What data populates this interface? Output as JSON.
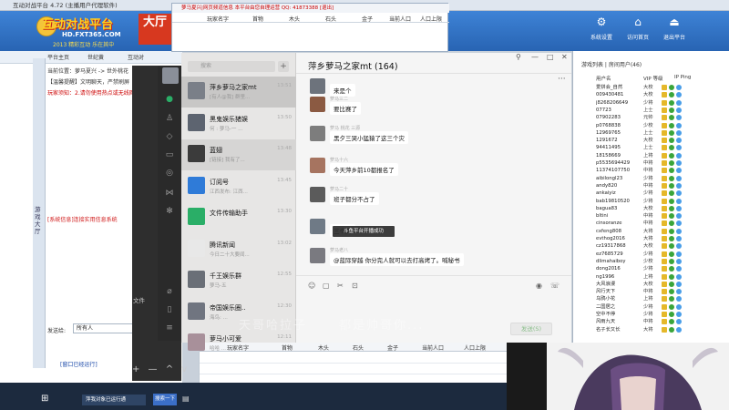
{
  "bg_window": {
    "title": "互动对战平台 4.72 (主播用户代理软件)",
    "logo_main": "互动对战平台",
    "logo_url": "HD.FXT365.COM",
    "logo_slogan": "2013 精彩互动 乐在其中",
    "hall_banner": "大厅",
    "top_buttons": [
      {
        "label": "系统设置",
        "icon": "gear-icon"
      },
      {
        "label": "访问首页",
        "icon": "home-icon"
      },
      {
        "label": "退出平台",
        "icon": "exit-icon"
      }
    ],
    "left_tabs": [
      "平台主页",
      "世纪黄",
      "互动对"
    ],
    "location": "当前位置：萝马夏兴 -> 世外桃花",
    "notice": "【温馨提醒】文明聊天，严禁刷屏",
    "tip": "玩家须知：2.请勿使用热点或无线网",
    "left_strip_text": "游戏大厅",
    "system_msg": "[系统信息]连接实用信息系统",
    "send_label": "发送给:",
    "send_target": "所有人",
    "back_link": "[窗口已经运行]"
  },
  "mini_window": {
    "title": "萝马夏兴|网页频道信息 本平台由您自理运营  QQ: 41873388   [退出]",
    "columns": [
      "玩家名字",
      "首物",
      "木头",
      "石头",
      "金子",
      "当前人口",
      "人口上限"
    ]
  },
  "right_panel": {
    "tabs": "游戏列表 | 房间用户(46)",
    "columns": [
      "用户名",
      "VIP 等级",
      "IP Ping"
    ],
    "users": [
      {
        "name": "爱拼会_自然",
        "level": "大校"
      },
      {
        "name": "009430481",
        "level": "大校"
      },
      {
        "name": "j8268206649",
        "level": "少将"
      },
      {
        "name": "07723",
        "level": "上士"
      },
      {
        "name": "07902283",
        "level": "元帅"
      },
      {
        "name": "p0768838",
        "level": "少校"
      },
      {
        "name": "12969765",
        "level": "上士"
      },
      {
        "name": "1291672",
        "level": "大校"
      },
      {
        "name": "94411495",
        "level": "上士"
      },
      {
        "name": "18158669",
        "level": "上将"
      },
      {
        "name": "p5535694429",
        "level": "中将"
      },
      {
        "name": "11374107750",
        "level": "中将"
      },
      {
        "name": "aibilongl23",
        "level": "少将"
      },
      {
        "name": "andy820",
        "level": "中将"
      },
      {
        "name": "ankaiyiz",
        "level": "少将"
      },
      {
        "name": "bab19810520",
        "level": "少将"
      },
      {
        "name": "bagua83",
        "level": "大校"
      },
      {
        "name": "bltini",
        "level": "中将"
      },
      {
        "name": "cinsoranze",
        "level": "中将"
      },
      {
        "name": "cxfeng808",
        "level": "大将"
      },
      {
        "name": "evthog2016",
        "level": "大将"
      },
      {
        "name": "cz19317868",
        "level": "大校"
      },
      {
        "name": "ez7685729",
        "level": "少将"
      },
      {
        "name": "dlimahaiboy",
        "level": "少校"
      },
      {
        "name": "dong2016",
        "level": "少将"
      },
      {
        "name": "ng1996",
        "level": "上将"
      },
      {
        "name": "大风浪漫",
        "level": "大校"
      },
      {
        "name": "风行天下",
        "level": "中将"
      },
      {
        "name": "乌鸦小花",
        "level": "上将"
      },
      {
        "name": "二国居之",
        "level": "少将"
      },
      {
        "name": "空中不停",
        "level": "少将"
      },
      {
        "name": "风雨九天",
        "level": "中将"
      },
      {
        "name": "名子长又长",
        "level": "大将"
      }
    ]
  },
  "bottom_grid": {
    "columns": [
      "玩家名字",
      "首物",
      "木头",
      "石头",
      "金子",
      "当前人口",
      "人口上限"
    ]
  },
  "wechat": {
    "search_placeholder": "搜索",
    "add_button": "+",
    "chats": [
      {
        "name": "萍乡萝马之家mt",
        "preview": "[有人@我] 群里...",
        "time": "13:51",
        "color": "#7a7f88"
      },
      {
        "name": "黑鬼娱乐猪娱",
        "preview": "何 : 萝马-一 ...",
        "time": "13:50",
        "color": "#5d6470"
      },
      {
        "name": "蓝翅",
        "preview": "[链接] 我有了...",
        "time": "13:48",
        "color": "#3b3b3b"
      },
      {
        "name": "订阅号",
        "preview": "江西发布: 江西...",
        "time": "13:45",
        "color": "#2f7bd8"
      },
      {
        "name": "文件传输助手",
        "preview": "",
        "time": "13:30",
        "color": "#2aae67"
      },
      {
        "name": "腾讯新闻",
        "preview": "今日二十大要闻...",
        "time": "13:02",
        "color": "#e8e8e8"
      },
      {
        "name": "千王娱乐群",
        "preview": "萝马-五",
        "time": "12:55",
        "color": "#6a6f77"
      },
      {
        "name": "帝国娱乐圈..",
        "preview": "海鸟: ...",
        "time": "12:30",
        "color": "#707580"
      },
      {
        "name": "萝马小可爱",
        "preview": "哈哈 ...",
        "time": "12:11",
        "color": "#a8909a"
      }
    ],
    "chat_title": "萍乡萝马之家mt (164)",
    "window_controls": [
      "⚲",
      "—",
      "□",
      "✕"
    ],
    "messages": [
      {
        "sender": "",
        "text": "来是个",
        "color": "#6d737c"
      },
      {
        "sender": "萝马三二",
        "text": "要比赛了",
        "color": "#8b5a42"
      },
      {
        "sender": "萝马 桃花 三源",
        "text": "黑夕三哭小猛猿了这三个灾",
        "color": "#7d7d7d"
      },
      {
        "sender": "萝马十六",
        "text": "今天萍乡前10都报名了",
        "color": "#a67460"
      },
      {
        "sender": "萝马二十",
        "text": "班子都分不占了",
        "color": "#5b5b5b"
      },
      {
        "sender": "",
        "text": "三个灾",
        "color": "#6f7a86"
      },
      {
        "sender": "萝马老八",
        "text": "@蓝际穿越 你分完人就可以去打高烤了。喊秘书",
        "color": "#7a7a80"
      }
    ],
    "toast": "斗鱼平台开播成功",
    "send_button": "发送(S)",
    "nav_label": "文件",
    "nav_bottom": "+ — ^ v"
  },
  "subtitles": [
    "天哥哈拉子",
    "都是帅哥你..."
  ],
  "taskbar": {
    "app": "萍我对象已运行通",
    "search": "搜索一下"
  }
}
